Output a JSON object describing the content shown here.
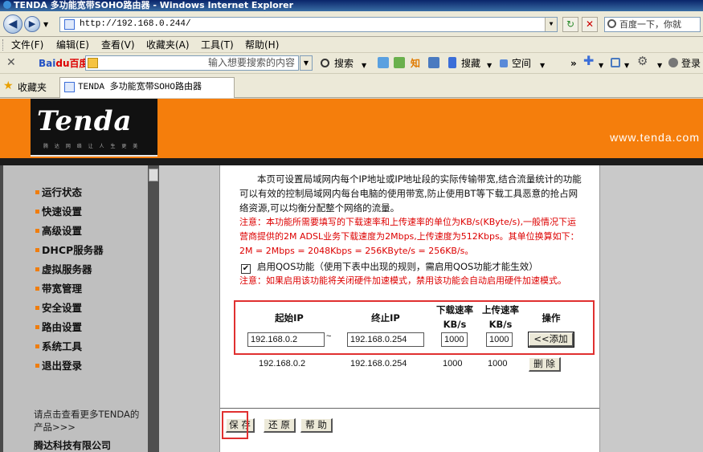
{
  "window": {
    "title": "TENDA 多功能宽带SOHO路由器 - Windows Internet Explorer"
  },
  "address": {
    "url": "http://192.168.0.244/",
    "search_placeholder": "百度一下，你就"
  },
  "menu": [
    "文件(F)",
    "编辑(E)",
    "查看(V)",
    "收藏夹(A)",
    "工具(T)",
    "帮助(H)"
  ],
  "toolbar": {
    "baidu_logo_a": "Bai",
    "baidu_logo_b": "du百度",
    "input_hint": "输入想要搜索的内容",
    "search_label": "搜索",
    "zhi_label": "知",
    "souzang_label": "搜藏",
    "kongjian_label": "空间",
    "login_label": "登录"
  },
  "favorites": {
    "label": "收藏夹",
    "tab_title": "TENDA 多功能宽带SOHO路由器"
  },
  "banner": {
    "logo": "Tenda",
    "logo_sub": "腾 达 网 络 让 人 生 更 美",
    "url": "www.tenda.com"
  },
  "sidebar": {
    "items": [
      "运行状态",
      "快速设置",
      "高级设置",
      "DHCP服务器",
      "虚拟服务器",
      "带宽管理",
      "安全设置",
      "路由设置",
      "系统工具",
      "退出登录"
    ],
    "more_text": "请点击查看更多TENDA的产品>>>",
    "company": "腾达科技有限公司"
  },
  "content": {
    "description": "本页可设置局域网内每个IP地址或IP地址段的实际传输带宽,结合流量统计的功能可以有效的控制局域网内每台电脑的使用带宽,防止使用BT等下载工具恶意的抢占网络资源,可以均衡分配整个网络的流量。",
    "warning": "注意：本功能所需要填写的下载速率和上传速率的单位为KB/s(KByte/s),一般情况下运营商提供的2M ADSL业务下载速度为2Mbps,上传速度为512Kbps。其单位换算如下： 2M = 2Mbps = 2048Kbps = 256KByte/s = 256KB/s。",
    "qos_label": "启用QOS功能（使用下表中出现的规则，需启用QOS功能才能生效）",
    "qos_checked": true,
    "warning2": "注意：如果启用该功能将关闭硬件加速模式，禁用该功能会自动启用硬件加速模式。"
  },
  "table": {
    "headers": {
      "start_ip": "起始IP",
      "end_ip": "终止IP",
      "download": "下载速率",
      "download_unit": "KB/s",
      "upload": "上传速率",
      "upload_unit": "KB/s",
      "action": "操作"
    },
    "input_row": {
      "start_ip": "192.168.0.2",
      "tilde": "~",
      "end_ip": "192.168.0.254",
      "download": "1000",
      "upload": "1000",
      "add_label": "<<添加"
    },
    "rules": [
      {
        "start_ip": "192.168.0.2",
        "end_ip": "192.168.0.254",
        "download": "1000",
        "upload": "1000",
        "delete_label": "删 除"
      }
    ]
  },
  "buttons": {
    "save": "保 存",
    "restore": "还 原",
    "help": "帮 助"
  },
  "colors": {
    "banner_orange": "#f57e0c",
    "highlight_red": "#e03030",
    "warning_red": "#dd0000"
  }
}
